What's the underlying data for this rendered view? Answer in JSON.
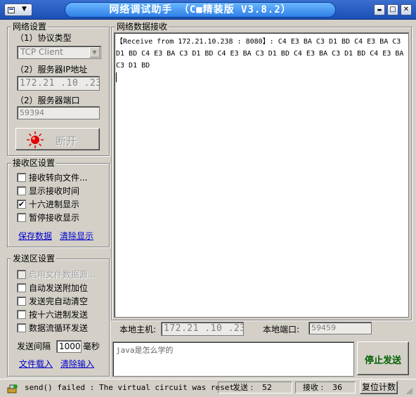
{
  "window": {
    "title": "网络调试助手 （C■精装版 V3.8.2）",
    "sysmenu_arrow": "▼",
    "min_label": "▬",
    "max_label": "□",
    "close_label": "✕"
  },
  "network_settings": {
    "group_title": "网络设置",
    "protocol_label": "（1）协议类型",
    "protocol_value": "TCP Client",
    "server_ip_label": "（2）服务器IP地址",
    "server_ip_value": "172.21 .10 .238",
    "server_port_label": "（2）服务器端口",
    "server_port_value": "59394",
    "connect_button_label": "断开",
    "connect_indicator_color": "#e00000"
  },
  "receive_settings": {
    "group_title": "接收区设置",
    "options": [
      {
        "label": "接收转向文件...",
        "checked": false,
        "mark": ""
      },
      {
        "label": "显示接收时间",
        "checked": false,
        "mark": ""
      },
      {
        "label": "十六进制显示",
        "checked": true,
        "mark": "✔"
      },
      {
        "label": "暂停接收显示",
        "checked": false,
        "mark": ""
      }
    ],
    "save_link": "保存数据",
    "clear_link": "清除显示"
  },
  "send_settings": {
    "group_title": "发送区设置",
    "options": [
      {
        "label": "启用文件数据源...",
        "checked": false,
        "disabled": true,
        "mark": ""
      },
      {
        "label": "自动发送附加位",
        "checked": false,
        "disabled": false,
        "mark": ""
      },
      {
        "label": "发送完自动清空",
        "checked": false,
        "disabled": false,
        "mark": ""
      },
      {
        "label": "按十六进制发送",
        "checked": false,
        "disabled": false,
        "mark": ""
      },
      {
        "label": "数据流循环发送",
        "checked": false,
        "disabled": false,
        "mark": ""
      }
    ],
    "interval_label": "发送间隔",
    "interval_value": "1000",
    "interval_unit": "毫秒",
    "load_file_link": "文件载入",
    "clear_input_link": "清除输入"
  },
  "receive_area": {
    "group_title": "网络数据接收",
    "header": "【Receive from 172.21.10.238 : 8080】:",
    "data": " C4 E3 BA C3 D1 BD C4 E3 BA C3 D1 BD C4 E3 BA C3 D1 BD C4 E3 BA C3 D1 BD C4 E3 BA C3 D1 BD C4 E3 BA C3 D1 BD"
  },
  "local": {
    "host_label": "本地主机:",
    "host_value": "172.21 .10 .238",
    "port_label": "本地端口:",
    "port_value": "59459"
  },
  "send_area": {
    "text": "java是怎么学的",
    "stop_button_label": "停止发送",
    "stop_button_color": "#006000"
  },
  "status": {
    "message": "send() failed : The virtual circuit was reset",
    "sent_label": "发送 :",
    "sent_count": "52",
    "received_label": "接收 :",
    "received_count": "36",
    "reset_label": "复位计数"
  }
}
